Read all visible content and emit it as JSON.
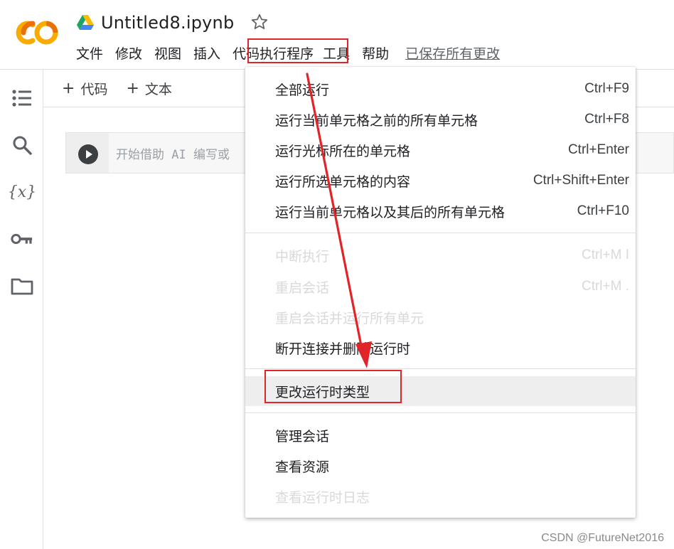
{
  "app": {
    "logo_text": "CO",
    "brand_orange": "#f9ab00",
    "brand_orange_dark": "#e8710a"
  },
  "notebook": {
    "title": "Untitled8.ipynb"
  },
  "menubar": {
    "items": [
      "文件",
      "修改",
      "视图",
      "插入",
      "代码执行程序",
      "工具",
      "帮助"
    ],
    "saved_status": "已保存所有更改"
  },
  "toolbar": {
    "add_code": "代码",
    "add_text": "文本",
    "plus": "+"
  },
  "sidebar": {
    "icons": [
      "toc-icon",
      "search-icon",
      "variables-icon",
      "key-icon",
      "folder-icon"
    ],
    "variables_glyph": "{x}"
  },
  "cell": {
    "placeholder": "开始借助 AI 编写或"
  },
  "runtime_menu": {
    "groups": [
      [
        {
          "label": "全部运行",
          "shortcut": "Ctrl+F9",
          "disabled": false
        },
        {
          "label": "运行当前单元格之前的所有单元格",
          "shortcut": "Ctrl+F8",
          "disabled": false
        },
        {
          "label": "运行光标所在的单元格",
          "shortcut": "Ctrl+Enter",
          "disabled": false
        },
        {
          "label": "运行所选单元格的内容",
          "shortcut": "Ctrl+Shift+Enter",
          "disabled": false
        },
        {
          "label": "运行当前单元格以及其后的所有单元格",
          "shortcut": "Ctrl+F10",
          "disabled": false
        }
      ],
      [
        {
          "label": "中断执行",
          "shortcut": "Ctrl+M I",
          "disabled": true
        },
        {
          "label": "重启会话",
          "shortcut": "Ctrl+M .",
          "disabled": true
        },
        {
          "label": "重启会话并运行所有单元",
          "shortcut": "",
          "disabled": true
        },
        {
          "label": "断开连接并删除运行时",
          "shortcut": "",
          "disabled": false
        }
      ],
      [
        {
          "label": "更改运行时类型",
          "shortcut": "",
          "disabled": false,
          "highlighted": true
        }
      ],
      [
        {
          "label": "管理会话",
          "shortcut": "",
          "disabled": false
        },
        {
          "label": "查看资源",
          "shortcut": "",
          "disabled": false
        },
        {
          "label": "查看运行时日志",
          "shortcut": "",
          "disabled": true
        }
      ]
    ]
  },
  "annotation": {
    "color": "#e0242a"
  },
  "watermark": "CSDN @FutureNet2016"
}
